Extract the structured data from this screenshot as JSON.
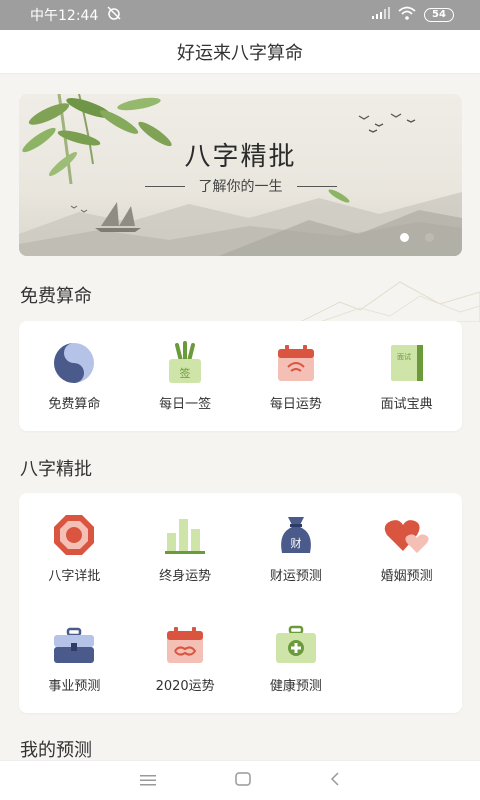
{
  "status": {
    "time": "中午12:44",
    "battery": "54"
  },
  "app": {
    "title": "好运来八字算命"
  },
  "banner": {
    "title": "八字精批",
    "subtitle": "了解你的一生"
  },
  "sections": {
    "free": {
      "title": "免费算命",
      "items": [
        {
          "label": "免费算命",
          "icon": "yin-yang-icon"
        },
        {
          "label": "每日一签",
          "icon": "fortune-stick-icon"
        },
        {
          "label": "每日运势",
          "icon": "calendar-icon"
        },
        {
          "label": "面试宝典",
          "icon": "book-icon"
        }
      ]
    },
    "bazi": {
      "title": "八字精批",
      "items": [
        {
          "label": "八字详批",
          "icon": "bagua-icon"
        },
        {
          "label": "终身运势",
          "icon": "bar-chart-icon"
        },
        {
          "label": "财运预测",
          "icon": "money-bag-icon"
        },
        {
          "label": "婚姻预测",
          "icon": "hearts-icon"
        },
        {
          "label": "事业预测",
          "icon": "briefcase-icon"
        },
        {
          "label": "2020运势",
          "icon": "calendar-cloud-icon"
        },
        {
          "label": "健康预测",
          "icon": "medical-kit-icon"
        }
      ]
    },
    "mine": {
      "title": "我的预测"
    }
  },
  "icon_text": {
    "fortune_stick": "签",
    "book": "面试",
    "money": "财"
  },
  "colors": {
    "accent_red": "#d9553f",
    "accent_green": "#8bbf5a",
    "accent_blue": "#4a5a8a"
  }
}
